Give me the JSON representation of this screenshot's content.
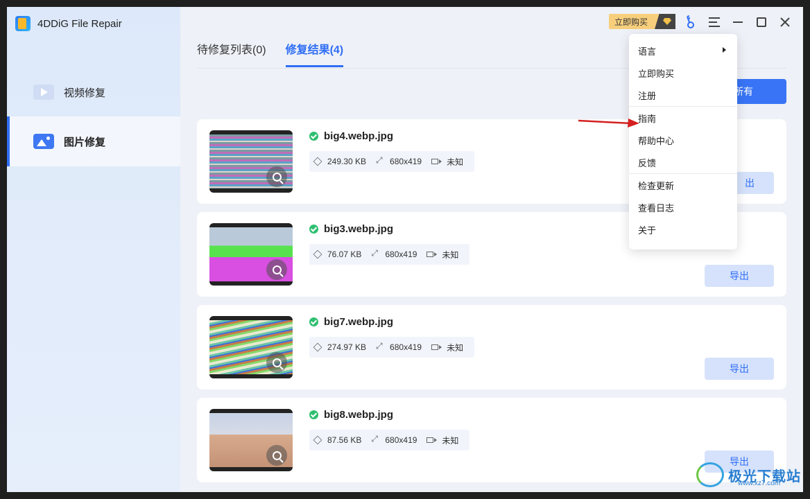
{
  "app": {
    "title": "4DDiG File Repair"
  },
  "sidebar": {
    "items": [
      {
        "label": "视频修复",
        "icon": "video-icon"
      },
      {
        "label": "图片修复",
        "icon": "image-icon",
        "active": true
      }
    ]
  },
  "tabs": [
    {
      "label": "待修复列表(0)"
    },
    {
      "label": "修复结果(4)",
      "active": true
    }
  ],
  "header": {
    "buy_label": "立即购买",
    "icons": [
      "diamond-icon",
      "key-icon",
      "menu-icon",
      "minimize-icon",
      "maximize-icon",
      "close-icon"
    ]
  },
  "export_all_label": "所有",
  "files": [
    {
      "name": "big4.webp.jpg",
      "size": "249.30 KB",
      "dims": "680x419",
      "duration": "未知",
      "export_label": "出"
    },
    {
      "name": "big3.webp.jpg",
      "size": "76.07 KB",
      "dims": "680x419",
      "duration": "未知",
      "export_label": "导出"
    },
    {
      "name": "big7.webp.jpg",
      "size": "274.97 KB",
      "dims": "680x419",
      "duration": "未知",
      "export_label": "导出"
    },
    {
      "name": "big8.webp.jpg",
      "size": "87.56 KB",
      "dims": "680x419",
      "duration": "未知",
      "export_label": "导出"
    }
  ],
  "menu": {
    "items": [
      "语言",
      "立即购买",
      "注册",
      "指南",
      "帮助中心",
      "反馈",
      "检查更新",
      "查看日志",
      "关于"
    ]
  },
  "watermark": {
    "text": "极光下载站",
    "sub": "www.xz7.com"
  },
  "colors": {
    "accent": "#2f6ef6",
    "success": "#2fbf71",
    "export_bg": "#d6e2fb"
  }
}
